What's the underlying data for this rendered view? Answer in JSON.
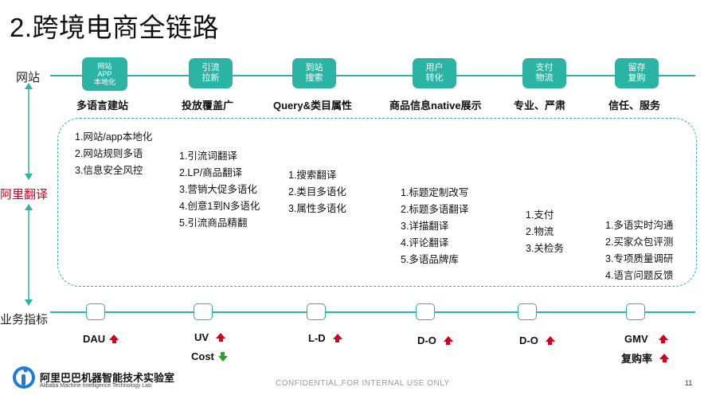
{
  "title": "2.跨境电商全链路",
  "rows": {
    "site": "网站",
    "ali": "阿里翻译",
    "metrics": "业务指标"
  },
  "stages": [
    {
      "box": "网站\nAPP\n本地化",
      "name": "多语言建站",
      "items": [
        "1.网站/app本地化",
        "2.网站规则多语",
        "3.信息安全风控"
      ]
    },
    {
      "box": "引流\n拉新",
      "name": "投放覆盖广",
      "items": [
        "1.引流词翻译",
        "2.LP/商品翻译",
        "3.营销大促多语化",
        "4.创意1到N多语化",
        "5.引流商品精翻"
      ]
    },
    {
      "box": "到站\n搜索",
      "name": "Query&类目属性",
      "items": [
        "1.搜索翻译",
        "2.类目多语化",
        "3.属性多语化"
      ]
    },
    {
      "box": "用户\n转化",
      "name": "商品信息native展示",
      "items": [
        "1.标题定制改写",
        "2.标题多语翻译",
        "3.详描翻译",
        "4.评论翻译",
        "5.多语品牌库"
      ]
    },
    {
      "box": "支付\n物流",
      "name": "专业、严肃",
      "items": [
        "1.支付",
        "2.物流",
        "3.关检务"
      ]
    },
    {
      "box": "留存\n复购",
      "name": "信任、服务",
      "items": [
        "1.多语实时沟通",
        "2.买家众包评测",
        "3.专项质量调研",
        "4.语言问题反馈"
      ]
    }
  ],
  "metrics": [
    {
      "label": "DAU",
      "dir": "up"
    },
    {
      "label": "UV",
      "dir": "up",
      "extra_label": "Cost",
      "extra_dir": "down"
    },
    {
      "label": "L-D",
      "dir": "up"
    },
    {
      "label": "D-O",
      "dir": "up"
    },
    {
      "label": "D-O",
      "dir": "up"
    },
    {
      "label": "GMV",
      "dir": "up",
      "extra_label": "复购率",
      "extra_dir": "up"
    }
  ],
  "footer": {
    "logo_cn": "阿里巴巴机器智能技术实验室",
    "logo_en": "Alibaba Machine Intelligence Technology Lab",
    "confidential": "CONFIDENTIAL,FOR INTERNAL USE ONLY",
    "page": "11"
  },
  "colors": {
    "accent": "#2bb3a3",
    "red": "#d0021b",
    "green": "#2ca02c"
  }
}
